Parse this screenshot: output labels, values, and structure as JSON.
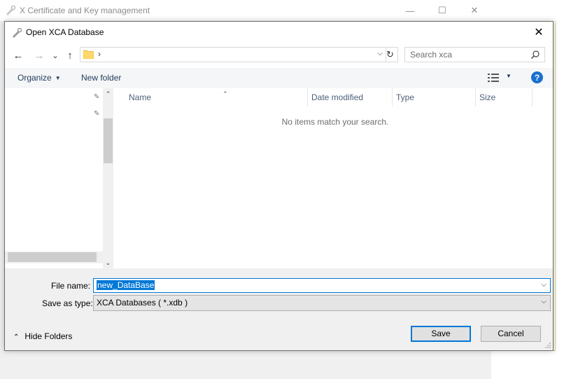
{
  "background_window": {
    "title": "X Certificate and Key management",
    "minimize_glyph": "—",
    "maximize_glyph": "☐",
    "close_glyph": "✕"
  },
  "dialog": {
    "title": "Open XCA Database",
    "close_glyph": "✕"
  },
  "navigation": {
    "back_glyph": "←",
    "forward_glyph": "→",
    "recent_glyph": "⌄",
    "up_glyph": "↑",
    "address_separator": "›",
    "address_dropdown_glyph": "⌵",
    "refresh_glyph": "↻",
    "search_placeholder": "Search xca",
    "icons": [
      "back-arrow-icon",
      "forward-arrow-icon",
      "chevron-down-icon",
      "up-arrow-icon",
      "folder-icon",
      "refresh-icon",
      "search-icon"
    ]
  },
  "commandbar": {
    "organize_label": "Organize",
    "organize_arrow": "▼",
    "new_folder_label": "New folder",
    "view_arrow": "▼",
    "help_glyph": "?"
  },
  "navpane": {
    "pin_glyph": "✎",
    "scroll_up_glyph": "⌃",
    "scroll_down_glyph": "⌄"
  },
  "filelist": {
    "sort_glyph": "⌃",
    "columns": [
      "Name",
      "Date modified",
      "Type",
      "Size"
    ],
    "empty_message": "No items match your search."
  },
  "bottom": {
    "file_name_label": "File name:",
    "file_name_value": "new_DataBase",
    "save_as_type_label": "Save as type:",
    "save_as_type_value": "XCA Databases ( *.xdb )",
    "dropdown_glyph": "⌵",
    "hide_folders_glyph": "⌃",
    "hide_folders_label": "Hide Folders",
    "save_button": "Save",
    "cancel_button": "Cancel"
  },
  "colors": {
    "accent": "#0078d7",
    "help": "#1a6fd1",
    "link_text": "#1e395b"
  }
}
